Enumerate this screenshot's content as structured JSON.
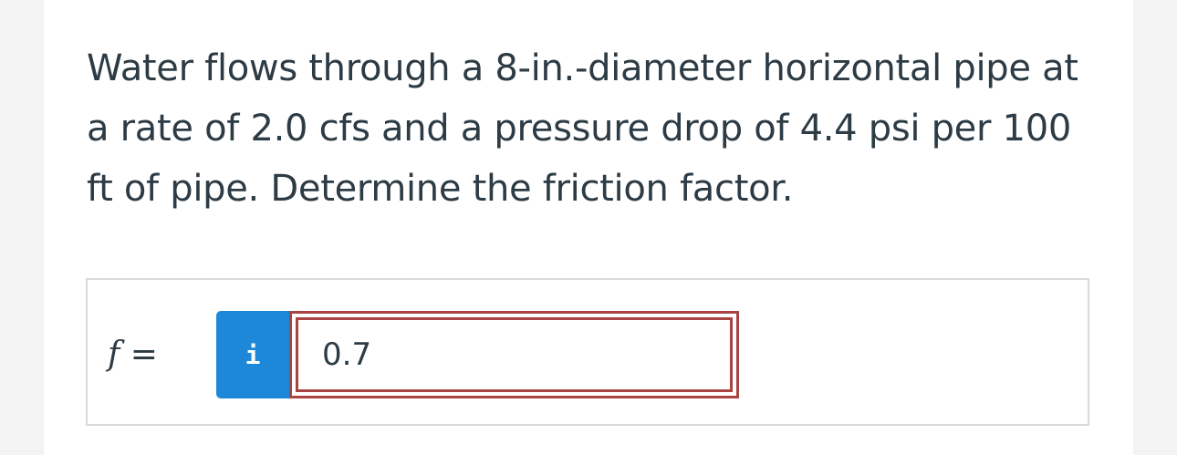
{
  "question": {
    "text": "Water flows through a 8-in.-diameter horizontal pipe at a rate of 2.0 cfs and a pressure drop of 4.4 psi per 100 ft of pipe. Determine the friction factor."
  },
  "answer": {
    "variable": "f",
    "equals": "=",
    "info_icon": "info-icon",
    "info_glyph": "i",
    "value": "0.7",
    "error_color": "#a94442",
    "accent_color": "#1e88d8"
  }
}
